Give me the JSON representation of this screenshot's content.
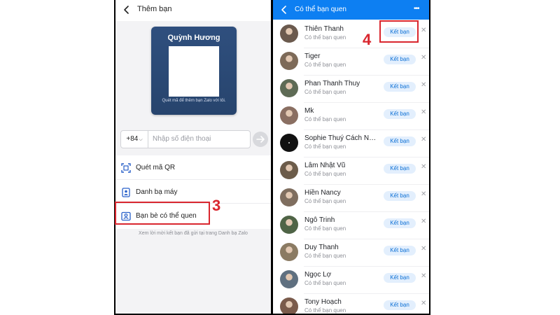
{
  "left": {
    "header_title": "Thêm bạn",
    "qr_card": {
      "name": "Quỳnh Hương",
      "caption": "Quét mã để thêm bạn Zalo với tôi."
    },
    "phone": {
      "country_code": "+84",
      "placeholder": "Nhập số điện thoại"
    },
    "menu": [
      {
        "label": "Quét mã QR",
        "icon": "qr-scan-icon"
      },
      {
        "label": "Danh bạ máy",
        "icon": "phonebook-icon"
      },
      {
        "label": "Bạn bè có thể quen",
        "icon": "contact-card-icon"
      }
    ],
    "hint": "Xem lời mời kết bạn đã gửi tại trang Danh bạ Zalo"
  },
  "right": {
    "header_title": "Có thể bạn quen",
    "more_label": "•••",
    "add_label": "Kết bạn",
    "subtitle": "Có thể bạn quen",
    "friends": [
      {
        "name": "Thiên Thanh"
      },
      {
        "name": "Tiger"
      },
      {
        "name": "Phan Thanh Thuy"
      },
      {
        "name": "Mk"
      },
      {
        "name": "Sophie Thuý Cách Nhi..."
      },
      {
        "name": "Lâm Nhật Vũ"
      },
      {
        "name": "Hiền Nancy"
      },
      {
        "name": "Ngô Trinh"
      },
      {
        "name": "Duy Thanh"
      },
      {
        "name": "Ngọc Lợ"
      },
      {
        "name": "Tony Hoạch"
      }
    ]
  },
  "annotations": {
    "step3": "3",
    "step4": "4"
  },
  "colors": {
    "zalo_blue": "#0d7ff2",
    "highlight_red": "#d9262e",
    "qr_card_bg": "#2f4f7e"
  }
}
